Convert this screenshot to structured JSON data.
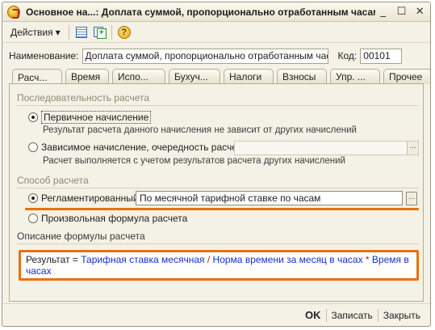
{
  "window": {
    "title": "Основное на...: Доплата суммой, пропорционально отработанным часам",
    "minimize": "_",
    "maximize": "☐",
    "close": "✕"
  },
  "toolbar": {
    "actions_label": "Действия",
    "actions_arrow": "▾",
    "help_glyph": "?"
  },
  "form": {
    "name_label": "Наименование:",
    "name_value": "Доплата суммой, пропорционально отработанным часам",
    "code_label": "Код:",
    "code_value": "00101"
  },
  "tabs": [
    {
      "label": "Расч..."
    },
    {
      "label": "Время"
    },
    {
      "label": "Испо..."
    },
    {
      "label": "Бухуч..."
    },
    {
      "label": "Налоги"
    },
    {
      "label": "Взносы"
    },
    {
      "label": "Упр. ..."
    },
    {
      "label": "Прочее"
    }
  ],
  "sequence": {
    "title": "Последовательность расчета",
    "primary_label": "Первичное начисление",
    "primary_hint": "Результат расчета данного начисления не зависит от других начислений",
    "dependent_label": "Зависимое начисление, очередность расчета:",
    "dependent_hint": "Расчет выполняется с учетом результатов расчета других начислений"
  },
  "method": {
    "title": "Способ расчета",
    "regulated_label": "Регламентированный:",
    "regulated_value": "По месячной тарифной ставке по часам",
    "custom_label": "Произвольная формула расчета"
  },
  "formula": {
    "title": "Описание формулы расчета",
    "result": "Результат",
    "eq": " = ",
    "term1": "Тарифная ставка месячная",
    "div": " / ",
    "term2": "Норма времени за месяц в часах",
    "mul": " * ",
    "term3": "Время в часах"
  },
  "buttons": {
    "ok": "OK",
    "save": "Записать",
    "close": "Закрыть",
    "dots": "..."
  },
  "colors": {
    "highlight": "#e8710f",
    "formula_term": "#1630c8",
    "formula_operator": "#c01c1c"
  }
}
